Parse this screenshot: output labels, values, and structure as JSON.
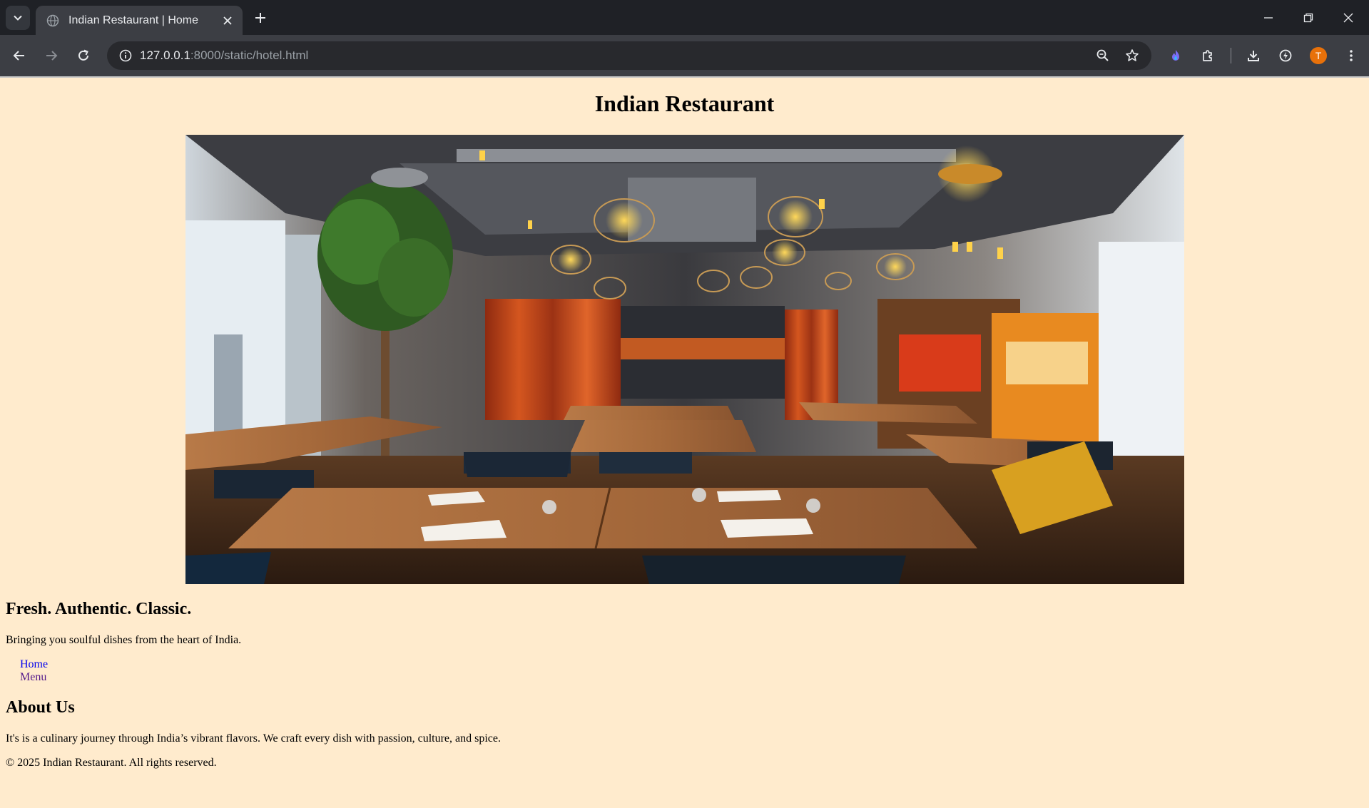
{
  "browser": {
    "tab_title": "Indian Restaurant | Home",
    "url_host": "127.0.0.1",
    "url_rest": ":8000/static/hotel.html",
    "profile_initial": "T"
  },
  "page": {
    "title": "Indian Restaurant",
    "hero_alt": "Restaurant interior",
    "tagline": "Fresh. Authentic. Classic.",
    "subtext": "Bringing you soulful dishes from the heart of India.",
    "nav": [
      {
        "label": "Home"
      },
      {
        "label": "Menu"
      }
    ],
    "about_heading": "About Us",
    "about_text": "It's is a culinary journey through India’s vibrant flavors. We craft every dish with passion, culture, and spice.",
    "footer": "© 2025 Indian Restaurant. All rights reserved."
  },
  "colors": {
    "page_bg": "#ffebcd",
    "chrome_dark": "#1f2126",
    "chrome_toolbar": "#3c3e44",
    "link": "#0000ee",
    "link_visited": "#551a8b",
    "avatar": "#e8710a"
  }
}
